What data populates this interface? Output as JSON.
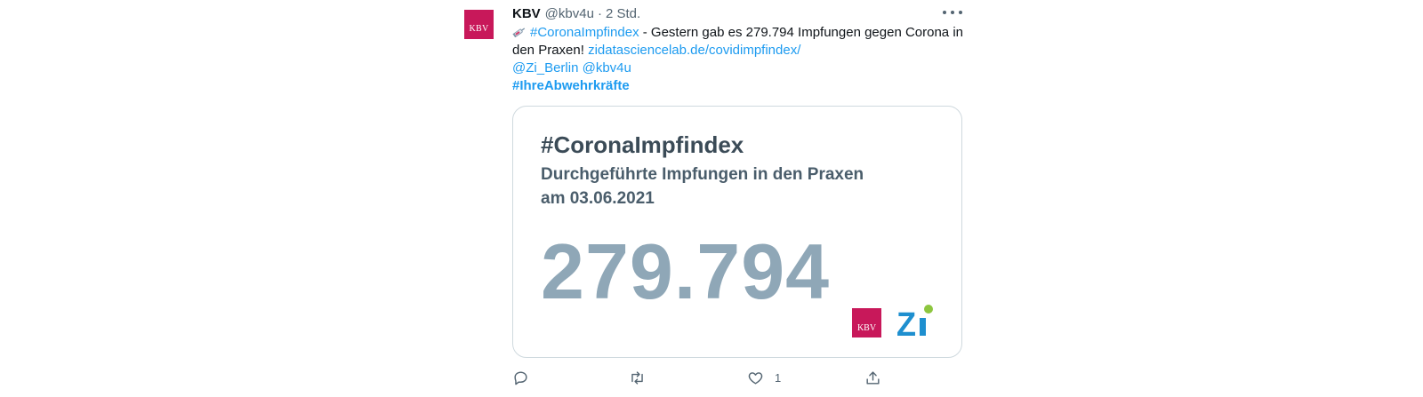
{
  "tweet": {
    "author": {
      "display_name": "KBV",
      "handle": "@kbv4u",
      "avatar_text": "KBV"
    },
    "separator": "·",
    "time": "2 Std.",
    "more_icon": "more-horizontal-icon",
    "body": {
      "emoji": "syringe-icon",
      "hashtag": "#CoronaImpfindex",
      "text_1": " - Gestern gab es 279.794 Impfungen gegen Corona in den Praxen! ",
      "link": "zidatasciencelab.de/covidimpfindex/",
      "mention_1": "@Zi_Berlin",
      "mention_2": "@kbv4u",
      "hashtag_2": "#IhreAbwehrkräfte"
    },
    "card": {
      "title": "#CoronaImpfindex",
      "subtitle_line_1": "Durchgeführte Impfungen in den Praxen",
      "subtitle_line_2": "am 03.06.2021",
      "number": "279.794",
      "logo_kbv_text": "KBV",
      "logo_zi_text": "Zi"
    },
    "actions": {
      "reply_icon": "reply-icon",
      "retweet_icon": "retweet-icon",
      "like_icon": "heart-icon",
      "like_count": "1",
      "share_icon": "share-icon"
    },
    "colors": {
      "link": "#1d9bf0",
      "brand_kbv": "#c8185a",
      "zi_blue": "#1e8fcf",
      "zi_green": "#8dc63f",
      "number_gray": "#8fa7b7"
    }
  }
}
